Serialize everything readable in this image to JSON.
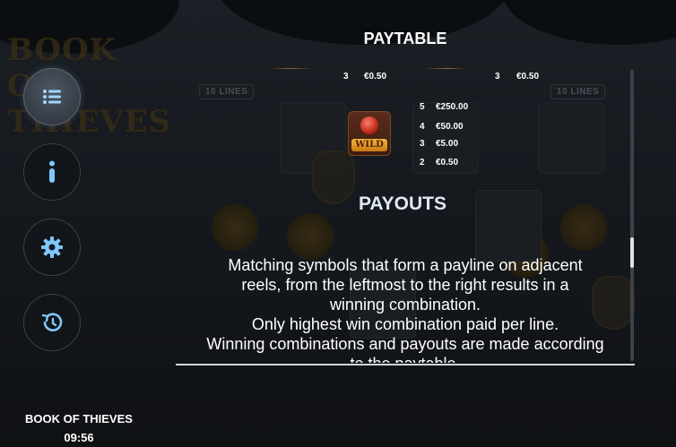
{
  "game": {
    "name": "BOOK OF THIEVES",
    "clock": "09:56",
    "logo_text": "BOOK OF THIEVES"
  },
  "background": {
    "lines_badge_left": "10 LINES",
    "lines_badge_right": "10 LINES"
  },
  "menu": [
    {
      "id": "paytable",
      "icon": "list-icon",
      "active": true
    },
    {
      "id": "info",
      "icon": "info-icon",
      "active": false
    },
    {
      "id": "settings",
      "icon": "gear-icon",
      "active": false
    },
    {
      "id": "history",
      "icon": "history-icon",
      "active": false
    }
  ],
  "paytable": {
    "title": "PAYTABLE",
    "top_row": [
      {
        "count": "3",
        "value": "€0.50"
      },
      {
        "count": "3",
        "value": "€0.50"
      }
    ],
    "wild": {
      "label": "WILD",
      "pays": [
        {
          "count": "5",
          "value": "€250.00"
        },
        {
          "count": "4",
          "value": "€50.00"
        },
        {
          "count": "3",
          "value": "€5.00"
        },
        {
          "count": "2",
          "value": "€0.50"
        }
      ]
    }
  },
  "payouts": {
    "title": "PAYOUTS",
    "lines": [
      "Matching symbols that form a payline on adjacent",
      "reels, from the leftmost to the right results in a",
      "winning combination.",
      "Only highest win combination paid per line.",
      "Winning combinations and payouts are made according",
      "to the paytable."
    ]
  },
  "colors": {
    "accent": "#c97a14",
    "text": "#ffffff",
    "heading": "#dfe8f3",
    "panel_bg": "#15191e"
  },
  "scrollbar": {
    "position_fraction": 0.58
  }
}
